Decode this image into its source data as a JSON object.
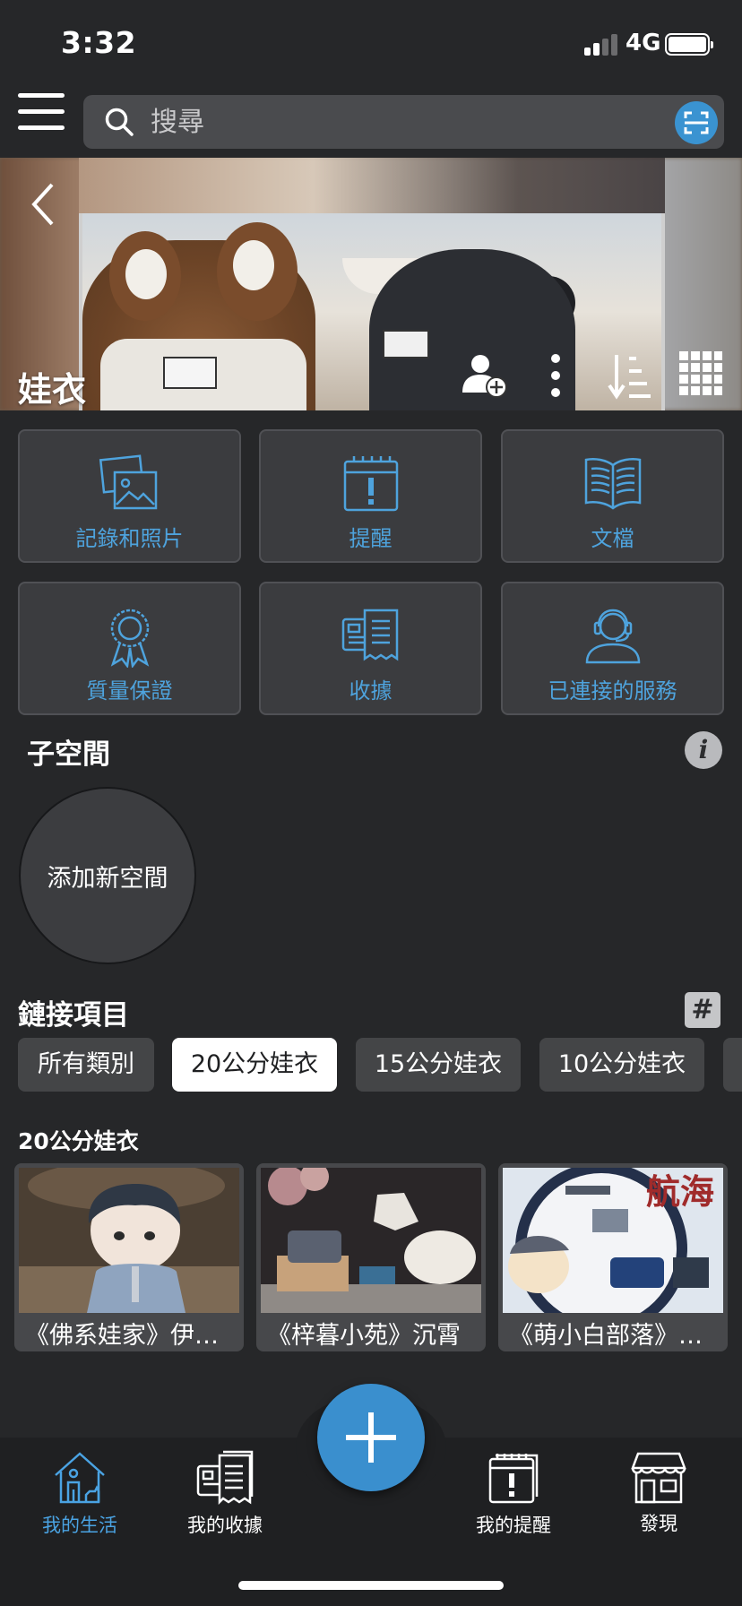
{
  "status_bar": {
    "time": "3:32",
    "network": "4G"
  },
  "search": {
    "placeholder": "搜尋"
  },
  "space": {
    "title": "娃衣"
  },
  "tiles": [
    {
      "label": "記錄和照片",
      "icon": "photos-icon"
    },
    {
      "label": "提醒",
      "icon": "reminder-icon"
    },
    {
      "label": "文檔",
      "icon": "book-icon"
    },
    {
      "label": "質量保證",
      "icon": "warranty-ribbon-icon"
    },
    {
      "label": "收據",
      "icon": "receipt-icon"
    },
    {
      "label": "已連接的服務",
      "icon": "support-agent-icon"
    }
  ],
  "subspaces": {
    "title": "子空間",
    "add_label": "添加新空間"
  },
  "linked": {
    "title": "鏈接項目",
    "chips": [
      "所有類別",
      "20公分娃衣",
      "15公分娃衣",
      "10公分娃衣"
    ],
    "selected_chip": "20公分娃衣"
  },
  "cards": {
    "title": "20公分娃衣",
    "items": [
      {
        "title": "《佛系娃家》伊…"
      },
      {
        "title": "《梓暮小苑》沉霄"
      },
      {
        "title": "《萌小白部落》…"
      }
    ]
  },
  "nav": {
    "items": [
      {
        "label": "我的生活",
        "active": true
      },
      {
        "label": "我的收據",
        "active": false
      },
      {
        "label": "我的提醒",
        "active": false
      },
      {
        "label": "發現",
        "active": false
      }
    ]
  },
  "colors": {
    "accent": "#3a8fce",
    "tile_label": "#4ea3dd",
    "background": "#262729"
  }
}
